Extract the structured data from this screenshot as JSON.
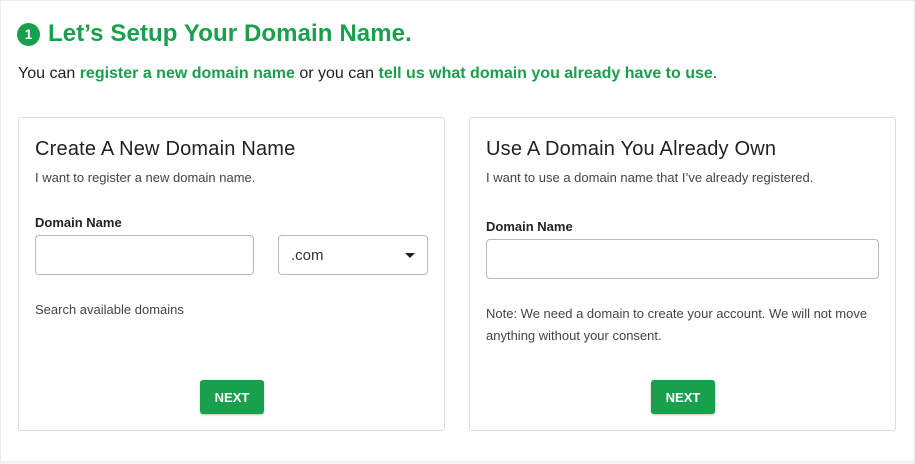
{
  "header": {
    "step_number": "1",
    "title": "Let’s Setup Your Domain Name."
  },
  "intro": {
    "prefix": "You can ",
    "link_register": "register a new domain name",
    "middle": " or you can ",
    "link_existing": "tell us what domain you already have to use",
    "suffix": "."
  },
  "new_domain_card": {
    "title": "Create A New Domain Name",
    "subtitle": "I want to register a new domain name.",
    "field_label": "Domain Name",
    "input_value": "",
    "tld_selected": ".com",
    "search_text": "Search available domains",
    "next_label": "NEXT"
  },
  "existing_domain_card": {
    "title": "Use A Domain You Already Own",
    "subtitle": "I want to use a domain name that I’ve already registered.",
    "field_label": "Domain Name",
    "input_value": "",
    "note": "Note: We need a domain to create your account. We will not move anything without your consent.",
    "next_label": "NEXT"
  },
  "colors": {
    "accent": "#18a04c",
    "text": "#222222",
    "border": "#dcdcdc"
  }
}
